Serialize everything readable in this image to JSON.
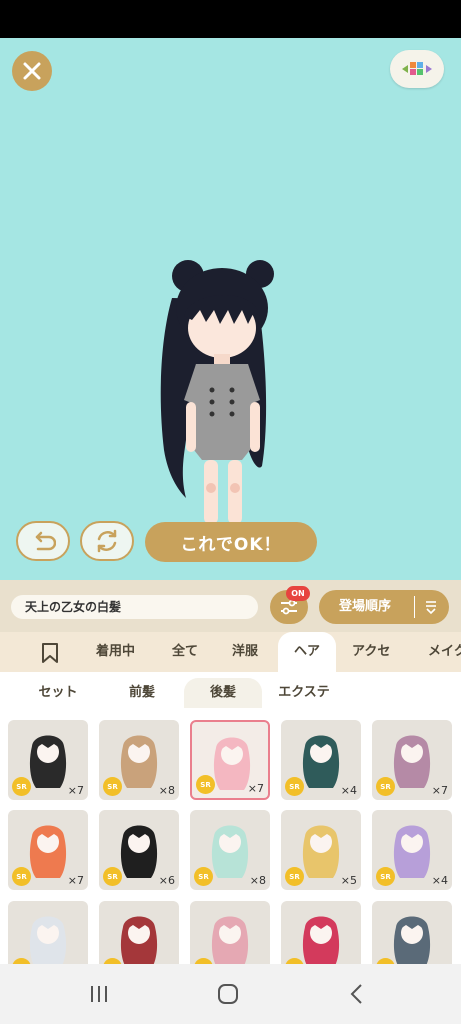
{
  "icons": {
    "close": "close-icon",
    "palette": "palette-icon",
    "undo": "undo-icon",
    "rotate": "rotate-icon",
    "filter": "filter-sliders-icon",
    "sort_toggle": "sort-toggle-icon",
    "bookmark": "bookmark-icon",
    "nav_recent": "recent-apps-icon",
    "nav_home": "home-icon",
    "nav_back": "back-icon"
  },
  "colors": {
    "stage_bg": "#a5e6e3",
    "accent_gold": "#c8a25c",
    "badge_red": "#e7443f",
    "sr_yellow": "#f2bf28",
    "selected_border": "#ea7f8d"
  },
  "actions": {
    "confirm_label": "これでOK！"
  },
  "item_name": "天上の乙女の白髪",
  "filter": {
    "badge": "ON"
  },
  "sort": {
    "label": "登場順序"
  },
  "category_tabs": [
    {
      "label": "着用中"
    },
    {
      "label": "全て"
    },
    {
      "label": "洋服"
    },
    {
      "label": "ヘア",
      "active": true
    },
    {
      "label": "アクセ"
    },
    {
      "label": "メイク"
    }
  ],
  "sub_tabs": [
    {
      "label": "セット"
    },
    {
      "label": "前髪"
    },
    {
      "label": "後髪",
      "active": true
    },
    {
      "label": "エクステ"
    }
  ],
  "items": [
    {
      "rarity": "SR",
      "count": "×7",
      "hair_color": "#2a2a2a"
    },
    {
      "rarity": "SR",
      "count": "×8",
      "hair_color": "#c9a27b"
    },
    {
      "rarity": "SR",
      "count": "×7",
      "hair_color": "#f4b7c1",
      "selected": true
    },
    {
      "rarity": "SR",
      "count": "×4",
      "hair_color": "#2f5b5a"
    },
    {
      "rarity": "SR",
      "count": "×7",
      "hair_color": "#b58aa6"
    },
    {
      "rarity": "SR",
      "count": "×7",
      "hair_color": "#ee7a4f"
    },
    {
      "rarity": "SR",
      "count": "×6",
      "hair_color": "#1f1f1f"
    },
    {
      "rarity": "SR",
      "count": "×8",
      "hair_color": "#b7e3d7"
    },
    {
      "rarity": "SR",
      "count": "×5",
      "hair_color": "#e8c56b"
    },
    {
      "rarity": "SR",
      "count": "×4",
      "hair_color": "#b79fd9"
    },
    {
      "rarity": "SR",
      "count": "",
      "hair_color": "#dfe4ea"
    },
    {
      "rarity": "SR",
      "count": "",
      "hair_color": "#a4373a"
    },
    {
      "rarity": "SR",
      "count": "",
      "hair_color": "#e5a8b3"
    },
    {
      "rarity": "SR",
      "count": "",
      "hair_color": "#d33a5c"
    },
    {
      "rarity": "SR",
      "count": "",
      "hair_color": "#5a6a78"
    }
  ]
}
